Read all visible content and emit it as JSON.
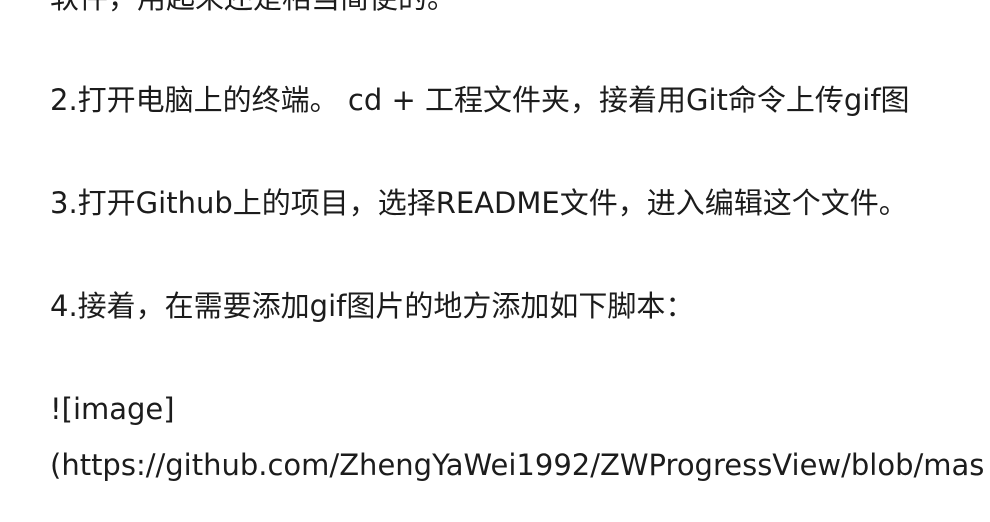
{
  "document": {
    "lines": [
      "软件，用起来还是相当简便的。",
      "2.打开电脑上的终端。 cd + 工程文件夹，接着用Git命令上传gif图",
      "3.打开Github上的项目，选择README文件，进入编辑这个文件。",
      "4.接着，在需要添加gif图片的地方添加如下脚本：",
      "![image]",
      "(https://github.com/ZhengYaWei1992/ZWProgressView/blob/mas"
    ]
  }
}
